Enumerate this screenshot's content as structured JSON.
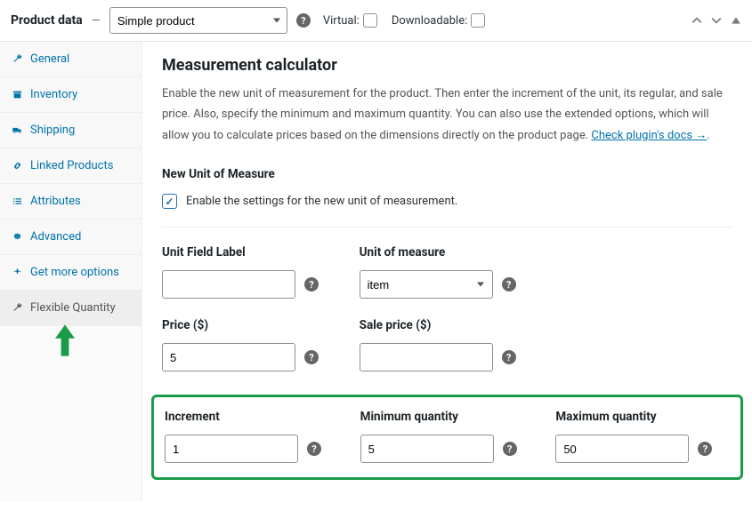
{
  "header": {
    "title": "Product data",
    "type_selected": "Simple product",
    "virtual_label": "Virtual:",
    "downloadable_label": "Downloadable:"
  },
  "sidebar": {
    "items": [
      {
        "label": "General",
        "icon": "wrench"
      },
      {
        "label": "Inventory",
        "icon": "archive"
      },
      {
        "label": "Shipping",
        "icon": "truck"
      },
      {
        "label": "Linked Products",
        "icon": "link"
      },
      {
        "label": "Attributes",
        "icon": "list"
      },
      {
        "label": "Advanced",
        "icon": "gear"
      },
      {
        "label": "Get more options",
        "icon": "spark"
      },
      {
        "label": "Flexible Quantity",
        "icon": "wrench"
      }
    ]
  },
  "section": {
    "title": "Measurement calculator",
    "desc_1": "Enable the new unit of measurement for the product. Then enter the increment of the unit, its regular, and sale price. Also, specify the minimum and maximum quantity. You can also use the extended options, which will allow you to calculate prices based on the dimensions directly on the product page. ",
    "docs_link": "Check plugin's docs →",
    "new_unit_heading": "New Unit of Measure",
    "enable_label": "Enable the settings for the new unit of measurement."
  },
  "fields": {
    "unit_field_label": {
      "label": "Unit Field Label",
      "value": ""
    },
    "unit_of_measure": {
      "label": "Unit of measure",
      "value": "item"
    },
    "price": {
      "label": "Price ($)",
      "value": "5"
    },
    "sale_price": {
      "label": "Sale price ($)",
      "value": ""
    },
    "increment": {
      "label": "Increment",
      "value": "1"
    },
    "min_qty": {
      "label": "Minimum quantity",
      "value": "5"
    },
    "max_qty": {
      "label": "Maximum quantity",
      "value": "50"
    }
  }
}
